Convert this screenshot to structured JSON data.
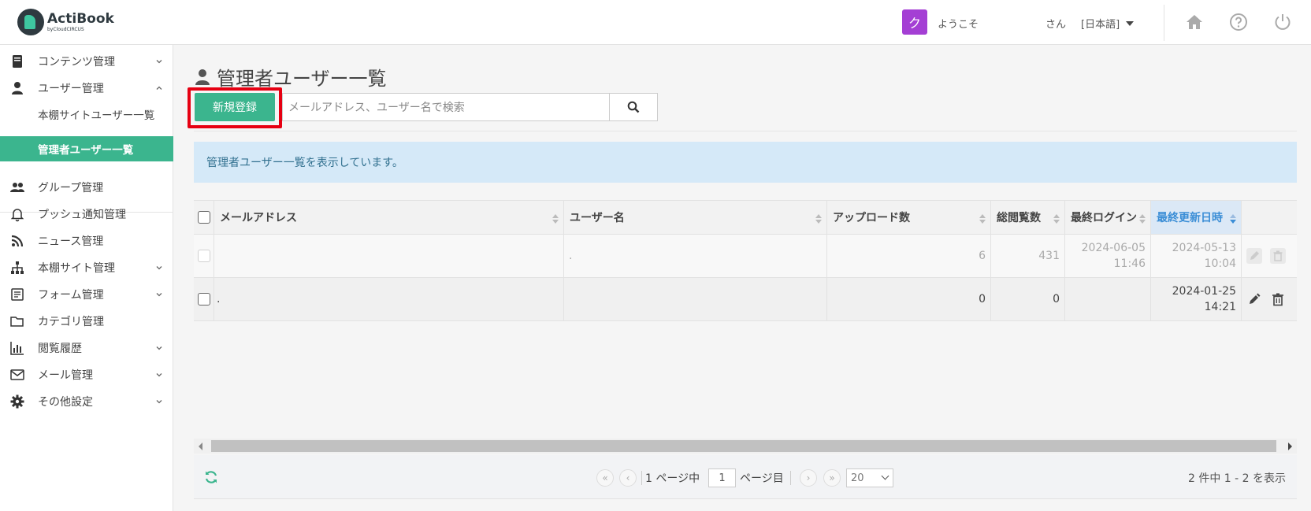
{
  "header": {
    "logo_title": "ActiBook",
    "logo_sub": "byCloudCIRCUS",
    "avatar_initial": "ク",
    "welcome": "ようこそ",
    "san": "さん",
    "language": "[日本語]"
  },
  "sidebar": {
    "items": [
      {
        "label": "コンテンツ管理",
        "icon": "book-icon",
        "chevron": "down"
      },
      {
        "label": "ユーザー管理",
        "icon": "user-icon",
        "chevron": "up"
      },
      {
        "label": "本棚サイトユーザー一覧"
      },
      {
        "label": "管理者ユーザー一覧",
        "active": true
      },
      {
        "label": "グループ管理",
        "icon": "users-icon"
      },
      {
        "label": "プッシュ通知管理",
        "icon": "bell-icon"
      },
      {
        "label": "ニュース管理",
        "icon": "rss-icon"
      },
      {
        "label": "本棚サイト管理",
        "icon": "sitemap-icon",
        "chevron": "down"
      },
      {
        "label": "フォーム管理",
        "icon": "form-icon",
        "chevron": "down"
      },
      {
        "label": "カテゴリ管理",
        "icon": "folder-icon"
      },
      {
        "label": "閲覧履歴",
        "icon": "bar-chart-icon",
        "chevron": "down"
      },
      {
        "label": "メール管理",
        "icon": "mail-icon",
        "chevron": "down"
      },
      {
        "label": "その他設定",
        "icon": "gear-icon",
        "chevron": "down"
      }
    ]
  },
  "main": {
    "title": "管理者ユーザー一覧",
    "new_button": "新規登録",
    "search_placeholder": "メールアドレス、ユーザー名で検索",
    "alert": "管理者ユーザー一覧を表示しています。"
  },
  "table": {
    "columns": [
      "メールアドレス",
      "ユーザー名",
      "アップロード数",
      "総閲覧数",
      "最終ログイン",
      "最終更新日時"
    ],
    "sorted_column": "最終更新日時",
    "rows": [
      {
        "email": "",
        "username": ".",
        "uploads": "6",
        "views": "431",
        "last_login_date": "2024-06-05",
        "last_login_time": "11:46",
        "updated_date": "2024-05-13",
        "updated_time": "10:04",
        "disabled": true
      },
      {
        "email": ".",
        "username": "",
        "uploads": "0",
        "views": "0",
        "last_login_date": "",
        "last_login_time": "",
        "updated_date": "2024-01-25",
        "updated_time": "14:21",
        "disabled": false
      }
    ]
  },
  "pager": {
    "page_prefix": "1 ページ中",
    "page_value": "1",
    "page_suffix": "ページ目",
    "page_size": "20",
    "info": "2 件中 1 - 2 を表示"
  },
  "colors": {
    "accent": "#3bb58e",
    "highlight_border": "#e60012",
    "avatar": "#a43fd4",
    "alert_bg": "#d5e9f8"
  }
}
